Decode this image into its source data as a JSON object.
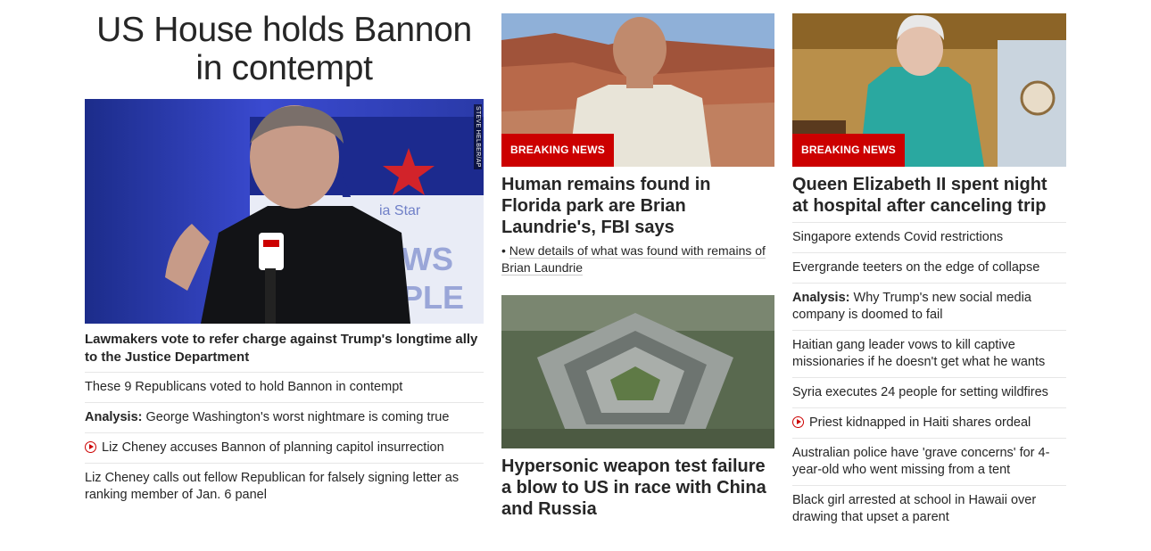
{
  "col1": {
    "headline": "US House holds Bannon in contempt",
    "photo_credit": "STEVE HELBER/AP",
    "lead": "Lawmakers vote to refer charge against Trump's longtime ally to the Justice Department",
    "items": [
      {
        "prefix": "",
        "text": "These 9 Republicans voted to hold Bannon in contempt",
        "video": false
      },
      {
        "prefix": "Analysis:",
        "text": "George Washington's worst nightmare is coming true",
        "video": false
      },
      {
        "prefix": "",
        "text": "Liz Cheney accuses Bannon of planning capitol insurrection",
        "video": true
      },
      {
        "prefix": "",
        "text": "Liz Cheney calls out fellow Republican for falsely signing letter as ranking member of Jan. 6 panel",
        "video": false
      }
    ]
  },
  "col2": {
    "story1": {
      "badge": "BREAKING NEWS",
      "title": "Human remains found in Florida park are Brian Laundrie's, FBI says",
      "sub": "New details of what was found with remains of Brian Laundrie"
    },
    "story2": {
      "title": "Hypersonic weapon test failure a blow to US in race with China and Russia"
    }
  },
  "col3": {
    "badge": "BREAKING NEWS",
    "title": "Queen Elizabeth II spent night at hospital after canceling trip",
    "items": [
      {
        "prefix": "",
        "text": "Singapore extends Covid restrictions",
        "video": false
      },
      {
        "prefix": "",
        "text": "Evergrande teeters on the edge of collapse",
        "video": false
      },
      {
        "prefix": "Analysis:",
        "text": "Why Trump's new social media company is doomed to fail",
        "video": false
      },
      {
        "prefix": "",
        "text": "Haitian gang leader vows to kill captive missionaries if he doesn't get what he wants",
        "video": false
      },
      {
        "prefix": "",
        "text": "Syria executes 24 people for setting wildfires",
        "video": false
      },
      {
        "prefix": "",
        "text": "Priest kidnapped in Haiti shares ordeal",
        "video": true
      },
      {
        "prefix": "",
        "text": "Australian police have 'grave concerns' for 4-year-old who went missing from a tent",
        "video": false
      },
      {
        "prefix": "",
        "text": "Black girl arrested at school in Hawaii over drawing that upset a parent",
        "video": false
      }
    ]
  },
  "colors": {
    "breaking_red": "#cc0000",
    "text": "#262626",
    "divider": "#e6e6e6"
  }
}
